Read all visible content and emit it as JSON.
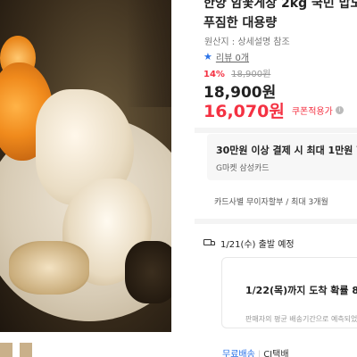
{
  "product": {
    "title_line1": "한양 암꽃게장 2kg 국민 밥도",
    "title_line2": "푸짐한 대용량",
    "origin": "원산지 : 상세설명 참조",
    "review_label": "리뷰 0개",
    "discount_percent": "14%",
    "original_price": "18,900원",
    "price": "18,900원",
    "coupon_price": "16,070원",
    "coupon_label": "쿠폰적용가",
    "coupon_info_icon": "i"
  },
  "card_promo": {
    "main": "30만원 이상 결제 시 최대 1만원 할",
    "sub": "G마켓 삼성카드"
  },
  "installment": "카드사별 무이자할부 / 최대 3개월",
  "delivery": {
    "departure": "1/21(수) 출발 예정",
    "arrival_main": "1/22(목)까지 도착 확률 8",
    "arrival_note": "판매자의 평균 배송기간으로 예측되었습",
    "shipping_fee": "무료배송",
    "carrier": "CJ택배"
  },
  "colors": {
    "accent_red": "#f43142",
    "link_blue": "#2b73e8"
  },
  "icons": [
    "star-icon",
    "info-icon",
    "truck-icon"
  ]
}
